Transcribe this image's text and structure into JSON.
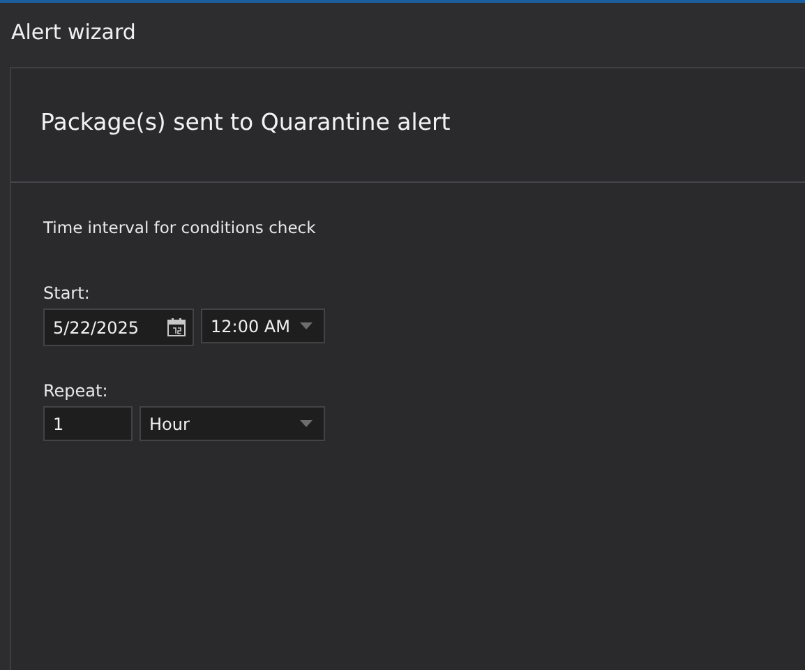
{
  "window": {
    "title": "Alert wizard"
  },
  "heading": "Package(s) sent to Quarantine alert",
  "section_label": "Time interval for conditions check",
  "start": {
    "label": "Start:",
    "date": "5/22/2025",
    "time": "12:00 AM"
  },
  "repeat": {
    "label": "Repeat:",
    "count": "1",
    "unit": "Hour"
  }
}
